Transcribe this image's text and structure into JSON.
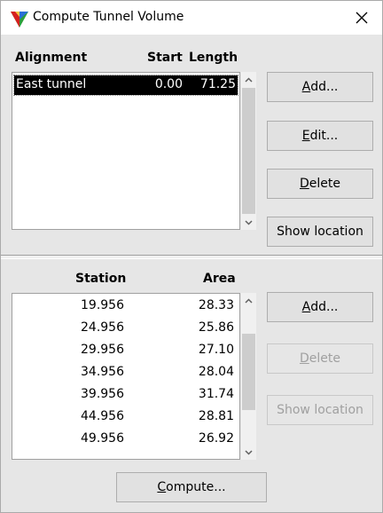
{
  "window": {
    "title": "Compute Tunnel Volume",
    "close_glyph": "✕"
  },
  "alignments": {
    "columns": {
      "alignment": "Alignment",
      "start": "Start",
      "length": "Length"
    },
    "rows": [
      {
        "alignment": "East tunnel",
        "start": "0.00",
        "length": "71.25",
        "selected": true
      }
    ],
    "buttons": {
      "add": {
        "first": "A",
        "rest": "dd..."
      },
      "edit": {
        "first": "E",
        "rest": "dit..."
      },
      "delete": {
        "first": "D",
        "rest": "elete"
      },
      "show_location": "Show location"
    }
  },
  "sections": {
    "columns": {
      "station": "Station",
      "area": "Area"
    },
    "rows": [
      {
        "station": "19.956",
        "area": "28.33"
      },
      {
        "station": "24.956",
        "area": "25.86"
      },
      {
        "station": "29.956",
        "area": "27.10"
      },
      {
        "station": "34.956",
        "area": "28.04"
      },
      {
        "station": "39.956",
        "area": "31.74"
      },
      {
        "station": "44.956",
        "area": "28.81"
      },
      {
        "station": "49.956",
        "area": "26.92"
      }
    ],
    "buttons": {
      "add": {
        "first": "A",
        "rest": "dd..."
      },
      "delete": {
        "first": "D",
        "rest": "elete"
      },
      "show_location": "Show location"
    }
  },
  "compute_button": {
    "first": "C",
    "rest": "ompute..."
  },
  "icons": {
    "app": "tunnel-app-icon",
    "close": "close-icon",
    "scroll_up": "chevron-up-icon",
    "scroll_down": "chevron-down-icon"
  },
  "colors": {
    "selection_bg": "#000000",
    "selection_fg": "#ffffff",
    "disabled_text": "#a0a0a0"
  }
}
